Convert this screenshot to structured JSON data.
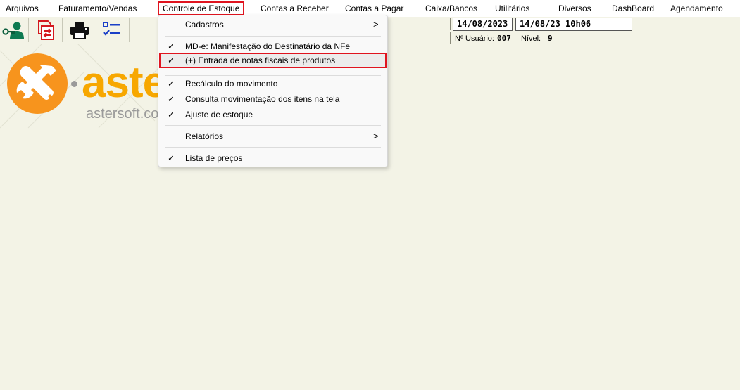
{
  "menubar": {
    "items": [
      "Arquivos",
      "Faturamento/Vendas",
      "Controle de Estoque",
      "Contas a Receber",
      "Contas a Pagar",
      "Caixa/Bancos",
      "Utilitários",
      "Diversos",
      "DashBoard",
      "Agendamento"
    ],
    "active": "Controle de Estoque"
  },
  "toolbar": {
    "buttons": [
      "user-key-icon",
      "exchange-document-icon",
      "printer-icon",
      "checklist-icon"
    ]
  },
  "status": {
    "date_field": "14/08/2023",
    "datetime_field": "14/08/23 10h06",
    "user_label": "Nº Usuário:",
    "user_value": "007",
    "level_label": "Nível:",
    "level_value": "9"
  },
  "logo": {
    "word": "aste",
    "url": "astersoft.co"
  },
  "dropdown": {
    "items": [
      {
        "label": "Cadastros",
        "check": "",
        "submenu": ">"
      },
      {
        "label": "MD-e: Manifestação do Destinatário da NFe",
        "check": "✓",
        "submenu": ""
      },
      {
        "label": "(+) Entrada de notas fiscais de produtos",
        "check": "✓",
        "submenu": ""
      },
      {
        "label": "Recálculo do movimento",
        "check": "✓",
        "submenu": ""
      },
      {
        "label": "Consulta movimentação dos itens na tela",
        "check": "✓",
        "submenu": ""
      },
      {
        "label": "Ajuste de estoque",
        "check": "✓",
        "submenu": ""
      },
      {
        "label": "Relatórios",
        "check": "",
        "submenu": ">"
      },
      {
        "label": "Lista de preços",
        "check": "✓",
        "submenu": ""
      }
    ],
    "highlighted": "(+) Entrada de notas fiscais de produtos"
  },
  "colors": {
    "background": "#f3f3e6",
    "highlight_border": "#e0141f",
    "logo_orange": "#f7941d",
    "logo_text": "#f7a700"
  }
}
